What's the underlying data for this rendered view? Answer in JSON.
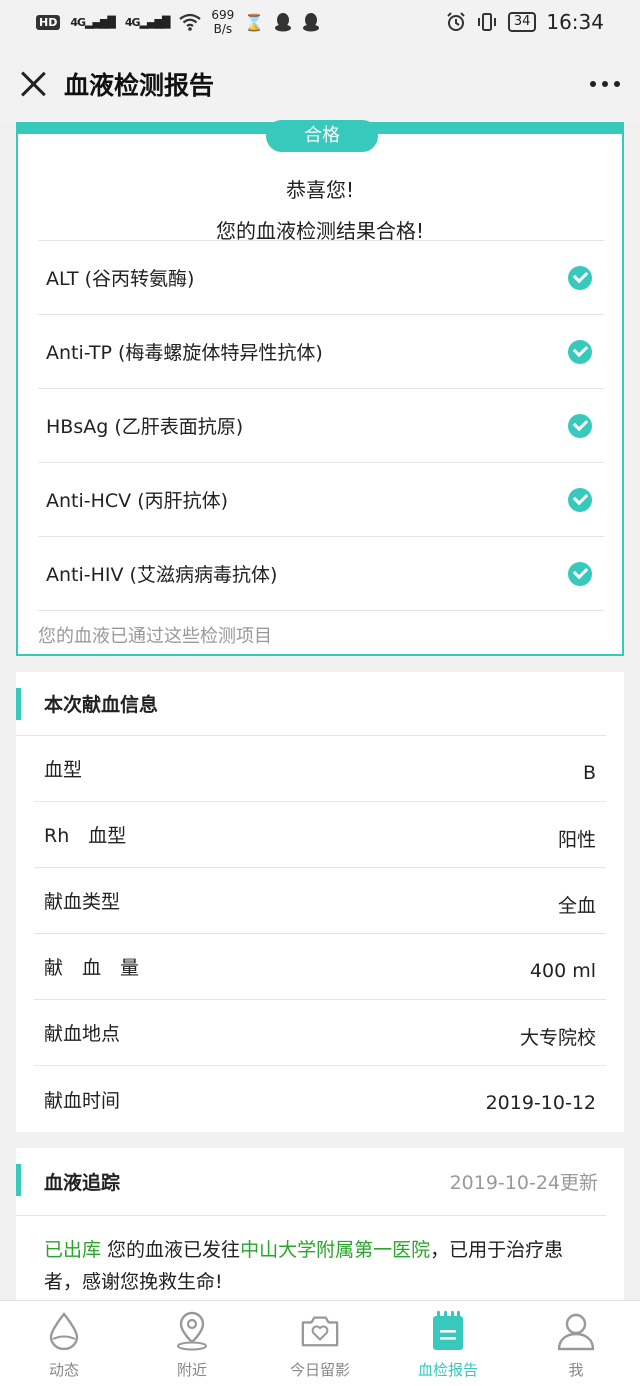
{
  "status_bar": {
    "hd": "HD",
    "signal1": "4G",
    "signal2": "4G",
    "speed_value": "699",
    "speed_unit": "B/s",
    "battery": "34",
    "time": "16:34"
  },
  "title_bar": {
    "title": "血液检测报告"
  },
  "result": {
    "badge": "合格",
    "congrats_line1": "恭喜您!",
    "congrats_line2": "您的血液检测结果合格!",
    "tests": [
      {
        "label": "ALT (谷丙转氨酶)"
      },
      {
        "label": "Anti-TP (梅毒螺旋体特异性抗体)"
      },
      {
        "label": "HBsAg (乙肝表面抗原)"
      },
      {
        "label": "Anti-HCV (丙肝抗体)"
      },
      {
        "label": "Anti-HIV (艾滋病病毒抗体)"
      }
    ],
    "note": "您的血液已通过这些检测项目"
  },
  "donation_info": {
    "title": "本次献血信息",
    "rows": [
      {
        "label": "血型",
        "value": "B"
      },
      {
        "label": "Rh　血型",
        "value": "阳性"
      },
      {
        "label": "献血类型",
        "value": "全血"
      },
      {
        "label": "献　血　量",
        "value": "400 ml"
      },
      {
        "label": "献血地点",
        "value": "大专院校"
      },
      {
        "label": "献血时间",
        "value": "2019-10-12"
      }
    ]
  },
  "tracking": {
    "title": "血液追踪",
    "updated": "2019-10-24更新",
    "status": "已出库",
    "text_before": " 您的血液已发往",
    "hospital": "中山大学附属第一医院",
    "text_after": "，已用于治疗患者，感谢您挽救生命!"
  },
  "bottom_nav": {
    "items": [
      {
        "label": "动态",
        "icon": "drop-icon"
      },
      {
        "label": "附近",
        "icon": "location-icon"
      },
      {
        "label": "今日留影",
        "icon": "camera-heart-icon"
      },
      {
        "label": "血检报告",
        "icon": "report-icon"
      },
      {
        "label": "我",
        "icon": "person-icon"
      }
    ],
    "active_index": 3
  },
  "colors": {
    "accent": "#38c9bd",
    "link_green": "#2aa52a"
  }
}
